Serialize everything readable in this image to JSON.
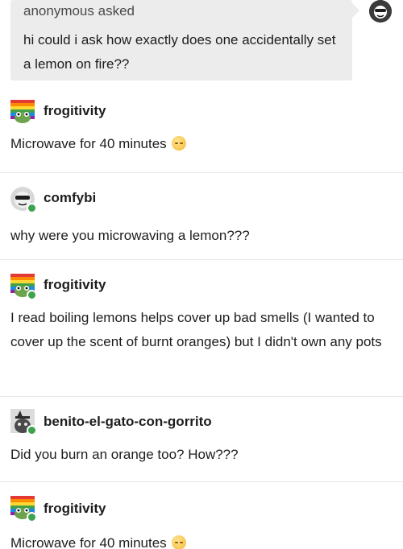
{
  "ask": {
    "asker": "anonymous asked",
    "question": "hi could i ask how exactly does one accidentally set a lemon on fire??"
  },
  "posts": [
    {
      "username": "frogitivity",
      "text": "Microwave for 40 minutes",
      "avatar_icon": "rainbow-frog-icon"
    },
    {
      "username": "comfybi",
      "text": "why were you microwaving a lemon???",
      "avatar_icon": "sunglasses-face-icon"
    },
    {
      "username": "frogitivity",
      "text": "I read boiling lemons helps cover up bad smells (I wanted to cover up the scent of burnt oranges) but I didn't own any pots",
      "avatar_icon": "rainbow-frog-icon"
    },
    {
      "username": "benito-el-gato-con-gorrito",
      "text": "Did you burn an orange too? How???",
      "avatar_icon": "cat-hat-icon"
    },
    {
      "username": "frogitivity",
      "text": "Microwave for 40 minutes",
      "avatar_icon": "rainbow-frog-icon"
    }
  ],
  "colors": {
    "ask_background": "#ececec",
    "text": "#1d1d1d",
    "divider": "#e6e6e6",
    "badge_green": "#3fa34d"
  }
}
